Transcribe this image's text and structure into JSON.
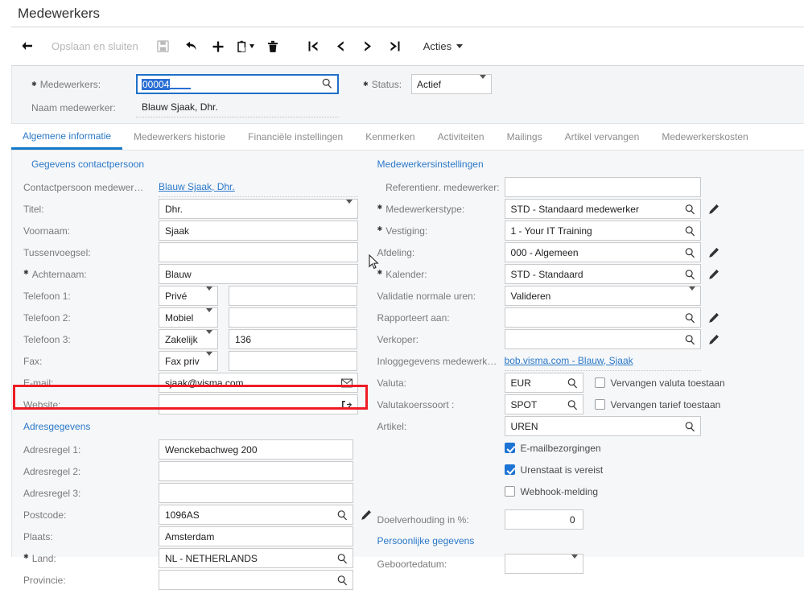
{
  "window": {
    "title": "Medewerkers"
  },
  "toolbar": {
    "back_icon": "back-arrow-icon",
    "save_close_label": "Opslaan en sluiten",
    "save_icon": "save-disk-icon",
    "undo_icon": "undo-arrow-icon",
    "add_icon": "plus-icon",
    "copy_icon": "copy-paste-icon",
    "delete_icon": "trash-icon",
    "first_icon": "first-record-icon",
    "prev_icon": "previous-record-icon",
    "next_icon": "next-record-icon",
    "last_icon": "last-record-icon",
    "actions_label": "Acties"
  },
  "summary": {
    "employee_label": "Medewerkers:",
    "employee_value": "00004",
    "employee_search_icon": "search-icon",
    "name_label": "Naam medewerker:",
    "name_value": "Blauw Sjaak, Dhr.",
    "status_label": "Status:",
    "status_value": "Actief",
    "status_caret_icon": "chevron-down-icon"
  },
  "tabs": [
    {
      "label": "Algemene informatie",
      "active": true
    },
    {
      "label": "Medewerkers historie",
      "active": false
    },
    {
      "label": "Financiële instellingen",
      "active": false
    },
    {
      "label": "Kenmerken",
      "active": false
    },
    {
      "label": "Activiteiten",
      "active": false
    },
    {
      "label": "Mailings",
      "active": false
    },
    {
      "label": "Artikel vervangen",
      "active": false
    },
    {
      "label": "Medewerkerskosten",
      "active": false
    }
  ],
  "left": {
    "contact_section": "Gegevens contactpersoon",
    "contact_person_label": "Contactpersoon medewer…",
    "contact_person_value": "Blauw Sjaak, Dhr.",
    "title_label": "Titel:",
    "title_value": "Dhr.",
    "firstname_label": "Voornaam:",
    "firstname_value": "Sjaak",
    "middlename_label": "Tussenvoegsel:",
    "middlename_value": "",
    "lastname_label": "Achternaam:",
    "lastname_value": "Blauw",
    "phone1_label": "Telefoon 1:",
    "phone1_type": "Privé",
    "phone1_value": "",
    "phone2_label": "Telefoon 2:",
    "phone2_type": "Mobiel",
    "phone2_value": "",
    "phone3_label": "Telefoon 3:",
    "phone3_type": "Zakelijk",
    "phone3_value": "136",
    "fax_label": "Fax:",
    "fax_type": "Fax priv",
    "fax_value": "",
    "email_label": "E-mail:",
    "email_value": "sjaak@visma.com",
    "email_icon": "envelope-icon",
    "website_label": "Website:",
    "website_value": "",
    "website_icon": "open-external-icon",
    "address_section": "Adresgegevens",
    "address1_label": "Adresregel 1:",
    "address1_value": "Wenckebachweg 200",
    "address2_label": "Adresregel 2:",
    "address2_value": "",
    "address3_label": "Adresregel 3:",
    "address3_value": "",
    "postcode_label": "Postcode:",
    "postcode_value": "1096AS",
    "city_label": "Plaats:",
    "city_value": "Amsterdam",
    "country_label": "Land:",
    "country_value": "NL - NETHERLANDS",
    "province_label": "Provincie:",
    "province_value": ""
  },
  "right": {
    "settings_section": "Medewerkersinstellingen",
    "refnr_label": "Referentienr. medewerker:",
    "refnr_value": "",
    "emptype_label": "Medewerkerstype:",
    "emptype_value": "STD - Standaard medewerker",
    "branch_label": "Vestiging:",
    "branch_value": "1 - Your IT Training",
    "dept_label": "Afdeling:",
    "dept_value": "000 - Algemeen",
    "calendar_label": "Kalender:",
    "calendar_value": "STD - Standaard",
    "validation_label": "Validatie normale uren:",
    "validation_value": "Valideren",
    "reports_label": "Rapporteert aan:",
    "reports_value": "",
    "seller_label": "Verkoper:",
    "seller_value": "",
    "login_label": "Inloggegevens medewerk…",
    "login_value": "bob.visma.com - Blauw, Sjaak",
    "currency_label": "Valuta:",
    "currency_value": "EUR",
    "currency_override_label": "Vervangen valuta toestaan",
    "currency_override_checked": false,
    "ratetype_label": "Valutakoerssoort :",
    "ratetype_value": "SPOT",
    "rate_override_label": "Vervangen tarief toestaan",
    "rate_override_checked": false,
    "item_label": "Artikel:",
    "item_value": "UREN",
    "mail_delivery_label": "E-mailbezorgingen",
    "mail_delivery_checked": true,
    "timesheet_label": "Urenstaat is vereist",
    "timesheet_checked": true,
    "webhook_label": "Webhook-melding",
    "webhook_checked": false,
    "target_label": "Doelverhouding in %:",
    "target_value": "0",
    "personal_section": "Persoonlijke gegevens",
    "birthdate_label": "Geboortedatum:",
    "birthdate_value": ""
  },
  "annotation": {
    "highlight_color": "#ee1c25",
    "highlighted_field": "E-mail"
  },
  "colors": {
    "accent": "#2a78c8",
    "tab_underline": "#1478c8",
    "checkbox_on": "#1c74d4",
    "focus_border": "#1e70c8",
    "selection": "#2a6fd4"
  }
}
